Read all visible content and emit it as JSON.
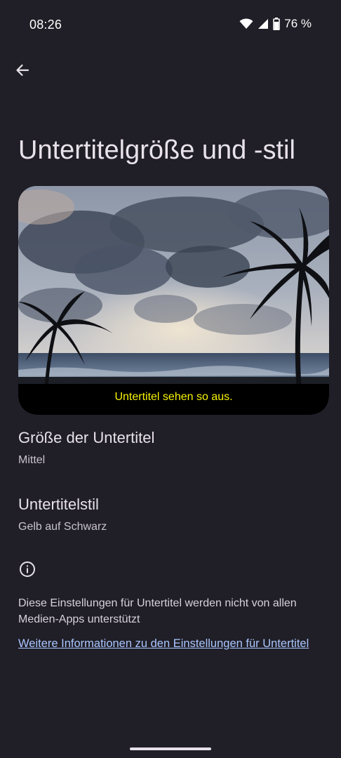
{
  "status_bar": {
    "time": "08:26",
    "battery": "76 %",
    "icons": [
      "wifi-icon",
      "signal-icon",
      "battery-icon"
    ]
  },
  "header": {
    "back_icon": "arrow-back-icon",
    "title": "Untertitelgröße und -stil"
  },
  "preview": {
    "caption": "Untertitel sehen so aus.",
    "caption_color": "#f7f400",
    "caption_background": "#000000"
  },
  "settings": [
    {
      "title": "Größe der Untertitel",
      "value": "Mittel"
    },
    {
      "title": "Untertitelstil",
      "value": "Gelb auf Schwarz"
    }
  ],
  "info": {
    "icon": "info-icon",
    "text": "Diese Einstellungen für Untertitel werden nicht von allen Medien-Apps unterstützt",
    "link": "Weitere Informationen zu den Einstellungen für Untertitel"
  },
  "colors": {
    "background": "#201e26",
    "link": "#a9c6ff"
  }
}
